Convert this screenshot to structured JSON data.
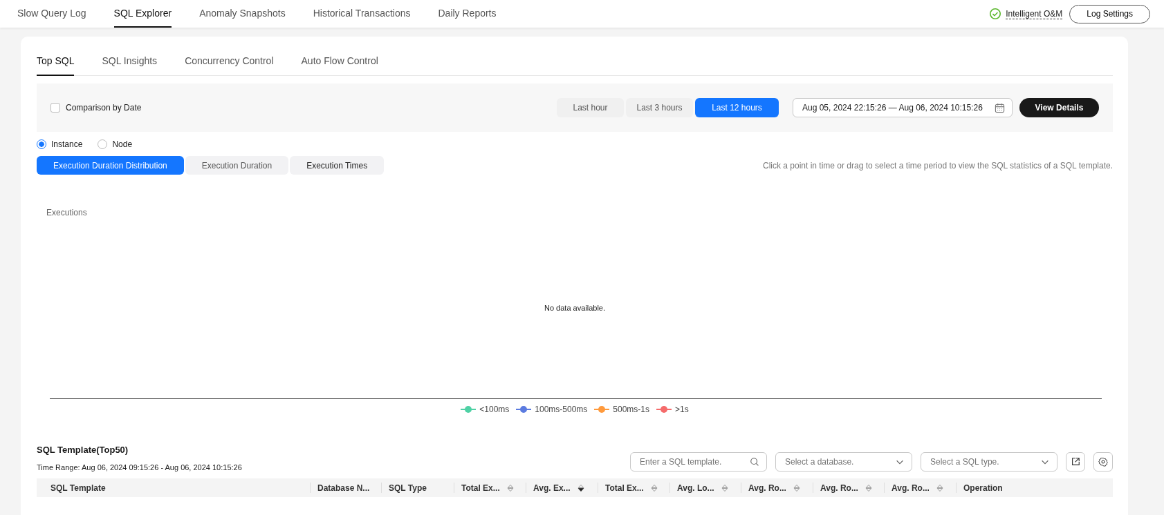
{
  "top_tabs": [
    {
      "label": "Slow Query Log",
      "selected": false
    },
    {
      "label": "SQL Explorer",
      "selected": true
    },
    {
      "label": "Anomaly Snapshots",
      "selected": false
    },
    {
      "label": "Historical Transactions",
      "selected": false
    },
    {
      "label": "Daily Reports",
      "selected": false
    }
  ],
  "top_actions": {
    "status_link": "Intelligent O&M",
    "log_settings": "Log Settings"
  },
  "sub_tabs": [
    {
      "label": "Top SQL",
      "selected": true
    },
    {
      "label": "SQL Insights",
      "selected": false
    },
    {
      "label": "Concurrency Control",
      "selected": false
    },
    {
      "label": "Auto Flow Control",
      "selected": false
    }
  ],
  "filter_bar": {
    "comparison": {
      "label": "Comparison by Date",
      "checked": false
    },
    "ranges": [
      {
        "label": "Last hour",
        "selected": false
      },
      {
        "label": "Last 3 hours",
        "selected": false
      },
      {
        "label": "Last 12 hours",
        "selected": true
      }
    ],
    "date_range": "Aug 05, 2024 22:15:26 — Aug 06, 2024 10:15:26",
    "view_details": "View Details"
  },
  "scope": [
    {
      "label": "Instance",
      "selected": true
    },
    {
      "label": "Node",
      "selected": false
    }
  ],
  "chart_tabs": [
    {
      "label": "Execution Duration Distribution",
      "selected": true
    },
    {
      "label": "Execution Duration",
      "selected": false
    },
    {
      "label": "Execution Times",
      "selected": false
    }
  ],
  "hint": "Click a point in time or drag to select a time period to view the SQL statistics of a SQL template.",
  "chart": {
    "ylabel": "Executions",
    "empty_text": "No data available.",
    "legend": [
      {
        "label": "<100ms",
        "color": "#4fd1a5"
      },
      {
        "label": "100ms-500ms",
        "color": "#5b7be0"
      },
      {
        "label": "500ms-1s",
        "color": "#ff9a3c"
      },
      {
        "label": ">1s",
        "color": "#f56b6b"
      }
    ]
  },
  "templates": {
    "title": "SQL Template(Top50)",
    "time_range": "Time Range: Aug 06, 2024 09:15:26 - Aug 06, 2024 10:15:26",
    "search": {
      "placeholder": "Enter a SQL template."
    },
    "database_select": {
      "placeholder": "Select a database."
    },
    "type_select": {
      "placeholder": "Select a SQL type."
    },
    "columns": [
      {
        "label": "SQL Template",
        "sortable": false
      },
      {
        "label": "Database N...",
        "sortable": false
      },
      {
        "label": "SQL Type",
        "sortable": false
      },
      {
        "label": "Total Ex...",
        "sortable": true
      },
      {
        "label": "Avg. Ex...",
        "sortable": true,
        "sorted_desc": true
      },
      {
        "label": "Total Ex...",
        "sortable": true
      },
      {
        "label": "Avg. Lo...",
        "sortable": true
      },
      {
        "label": "Avg. Ro...",
        "sortable": true
      },
      {
        "label": "Avg. Ro...",
        "sortable": true
      },
      {
        "label": "Avg. Ro...",
        "sortable": true
      },
      {
        "label": "Operation",
        "sortable": false
      }
    ]
  }
}
